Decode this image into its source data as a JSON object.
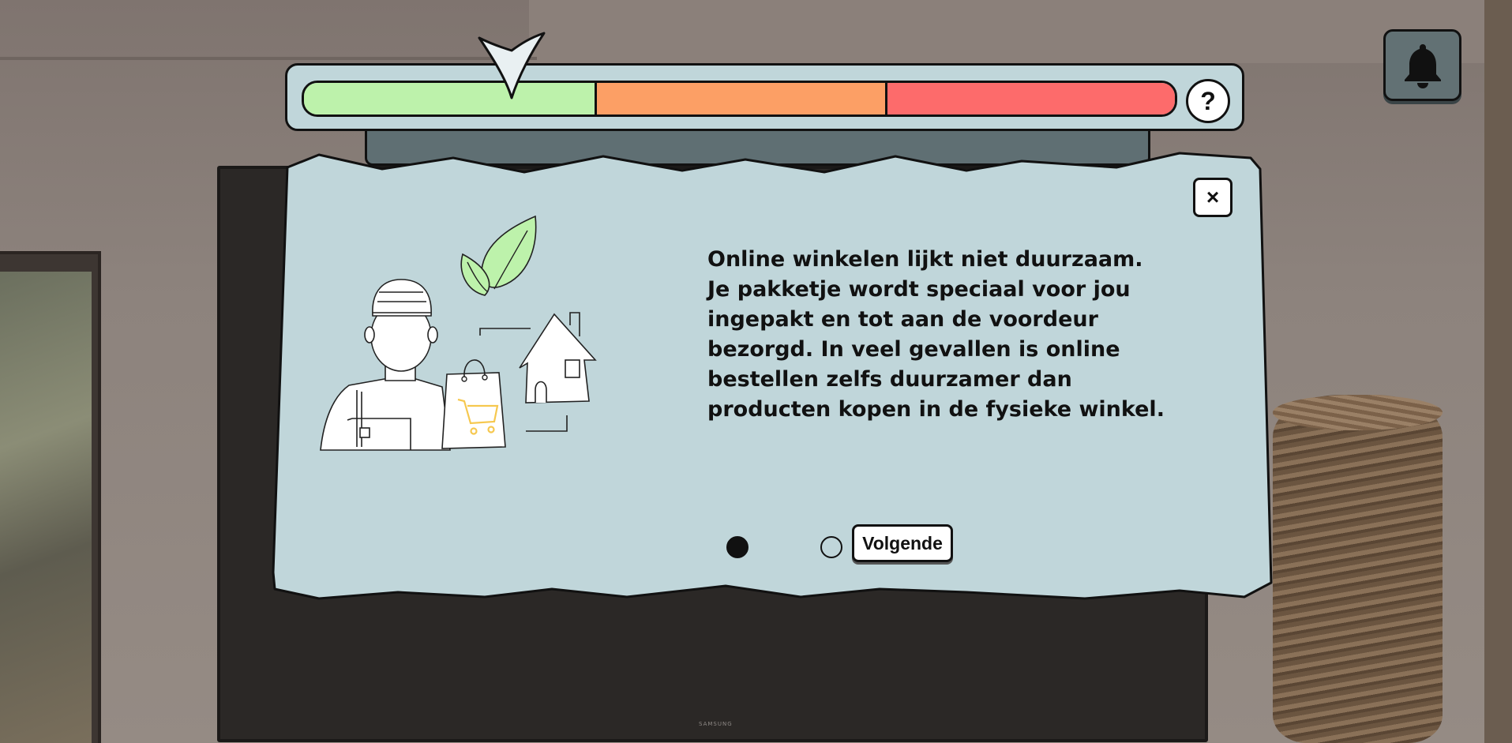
{
  "meter": {
    "pointer_value": 0.24,
    "segments": [
      {
        "name": "green",
        "color": "#bdf2ab"
      },
      {
        "name": "orange",
        "color": "#fc9f65"
      },
      {
        "name": "red",
        "color": "#fd6b6b"
      }
    ],
    "help_label": "?"
  },
  "dialog": {
    "close_label": "×",
    "text": "Online winkelen lijkt niet duurzaam. Je pakketje wordt speciaal voor jou ingepakt en tot aan de voordeur bezorgd. In veel gevallen is online bestellen zelfs duurzamer dan producten kopen in de fysieke winkel.",
    "pagination": {
      "current": 1,
      "total": 2
    },
    "next_label": "Volgende",
    "illustration_icons": [
      "delivery-worker-icon",
      "leaf-icon",
      "shopping-bag-icon",
      "shopping-cart-icon",
      "house-icon"
    ]
  },
  "toolbar": {
    "bell_icon": "bell-icon"
  },
  "colors": {
    "panel": "#c0d6da",
    "leaf": "#bdf2ab",
    "cart": "#f6d16a",
    "bell_button": "#627174"
  }
}
